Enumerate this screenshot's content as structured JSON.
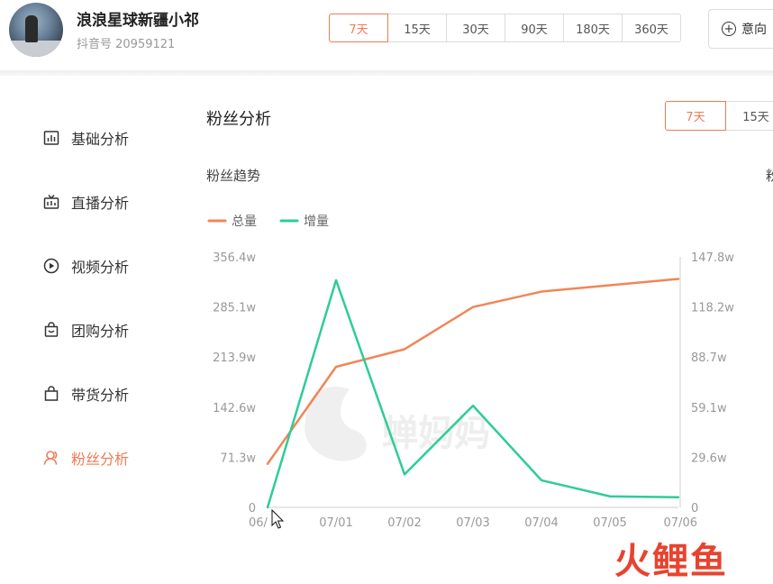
{
  "header": {
    "name": "浪浪星球新疆小祁",
    "uid": "抖音号 20959121",
    "ranges": [
      "7天",
      "15天",
      "30天",
      "90天",
      "180天",
      "360天"
    ],
    "active_range": "7天",
    "intent_label": "意向"
  },
  "sidebar": {
    "items": [
      {
        "label": "基础分析",
        "icon": "bar-chart-icon"
      },
      {
        "label": "直播分析",
        "icon": "live-tv-icon"
      },
      {
        "label": "视频分析",
        "icon": "play-circle-icon"
      },
      {
        "label": "团购分析",
        "icon": "shopping-bag-icon"
      },
      {
        "label": "带货分析",
        "icon": "goods-bag-icon"
      },
      {
        "label": "粉丝分析",
        "icon": "user-icon"
      }
    ],
    "active": "粉丝分析"
  },
  "main": {
    "title": "粉丝分析",
    "sub_ranges": [
      "7天",
      "15天"
    ],
    "active_sub_range": "7天",
    "trend_title": "粉丝趋势",
    "right_cut_label": "粉"
  },
  "chart_data": {
    "type": "line",
    "x": [
      "06/30",
      "07/01",
      "07/02",
      "07/03",
      "07/04",
      "07/05",
      "07/06"
    ],
    "x_tick_labels": [
      "06/",
      "07/01",
      "07/02",
      "07/03",
      "07/04",
      "07/05",
      "07/06"
    ],
    "series": [
      {
        "name": "总量",
        "axis": "left",
        "color": "#f08657",
        "values": [
          62,
          200,
          225,
          285,
          307,
          316,
          325
        ]
      },
      {
        "name": "增量",
        "axis": "right",
        "color": "#2ecc98",
        "values": [
          0,
          134,
          19.5,
          60,
          16,
          6.5,
          6
        ]
      }
    ],
    "left_axis": {
      "ylim": [
        0,
        356.4
      ],
      "ticks": [
        0,
        71.3,
        142.6,
        213.9,
        285.1,
        356.4
      ],
      "tick_labels": [
        "0",
        "71.3w",
        "142.6w",
        "213.9w",
        "285.1w",
        "356.4w"
      ]
    },
    "right_axis": {
      "ylim": [
        0,
        147.8
      ],
      "ticks": [
        0,
        29.6,
        59.1,
        88.7,
        118.2,
        147.8
      ],
      "tick_labels": [
        "0",
        "29.6w",
        "59.1w",
        "88.7w",
        "118.2w",
        "147.8w"
      ]
    },
    "legend_position": "top-left",
    "grid": false,
    "watermark": "蝉妈妈"
  },
  "footer_watermark": "火鲤鱼"
}
